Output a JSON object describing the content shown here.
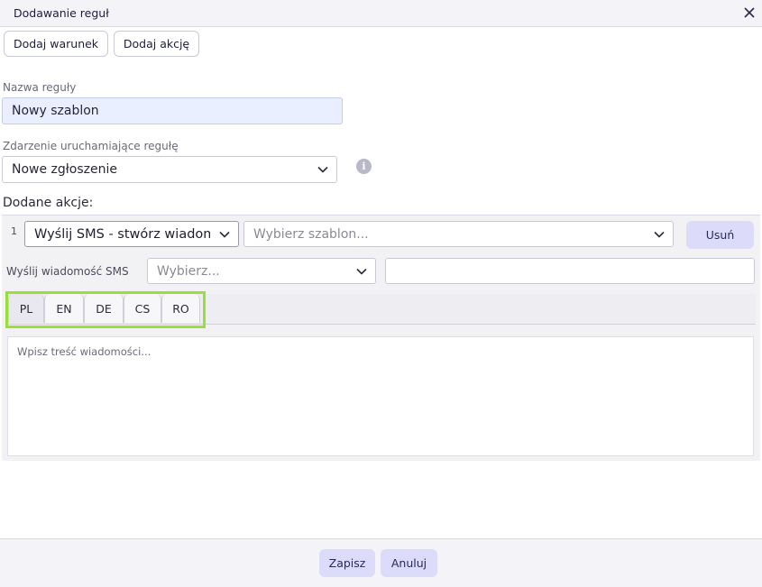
{
  "dialog": {
    "title": "Dodawanie reguł"
  },
  "toolbar": {
    "add_condition": "Dodaj warunek",
    "add_action": "Dodaj akcję"
  },
  "rule_name": {
    "label": "Nazwa reguły",
    "value": "Nowy szablon"
  },
  "trigger": {
    "label": "Zdarzenie uruchamiające regułę",
    "value": "Nowe zgłoszenie",
    "info_icon": "i"
  },
  "actions": {
    "title": "Dodane akcje:",
    "items": [
      {
        "number": "1",
        "type": "Wyślij SMS - stwórz wiadom",
        "template_placeholder": "Wybierz szablon...",
        "remove_label": "Usuń",
        "sms_label": "Wyślij wiadomość SMS",
        "sms_select_placeholder": "Wybierz...",
        "sms_value": "",
        "languages": [
          "PL",
          "EN",
          "DE",
          "CS",
          "RO"
        ],
        "active_language": "PL",
        "message_placeholder": "Wpisz treść wiadomości..."
      }
    ]
  },
  "footer": {
    "save": "Zapisz",
    "cancel": "Anuluj"
  },
  "colors": {
    "accent_button": "#dcdcfa",
    "highlight": "#97e03a",
    "input_filled": "#e9efff"
  }
}
